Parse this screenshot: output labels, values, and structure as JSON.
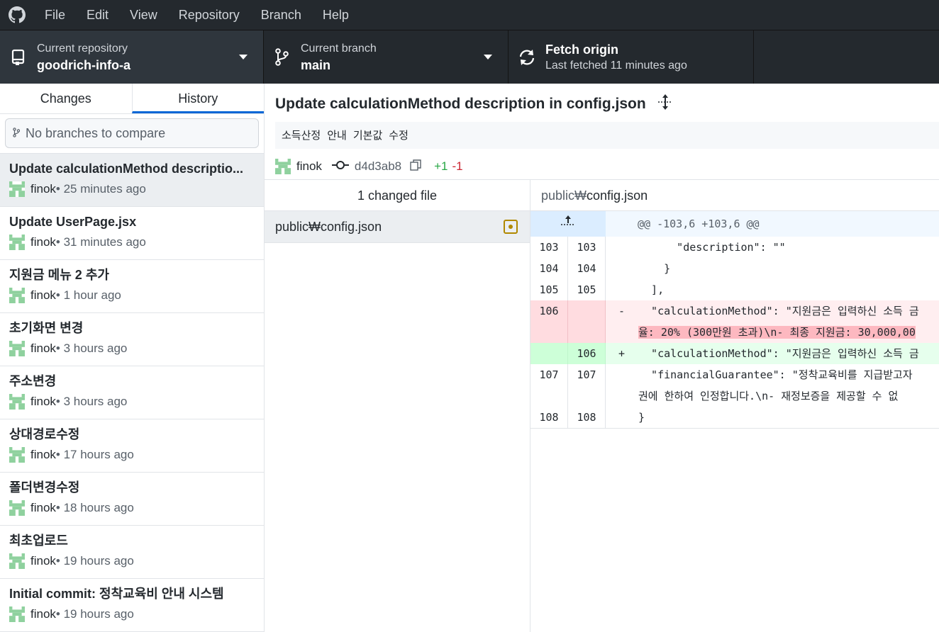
{
  "menu": [
    "File",
    "Edit",
    "View",
    "Repository",
    "Branch",
    "Help"
  ],
  "toolbar": {
    "repo_label": "Current repository",
    "repo_value": "goodrich-info-a",
    "branch_label": "Current branch",
    "branch_value": "main",
    "fetch_label": "Fetch origin",
    "fetch_sub": "Last fetched 11 minutes ago"
  },
  "sidebar": {
    "tabs": [
      "Changes",
      "History"
    ],
    "compare_placeholder": "No branches to compare",
    "commits": [
      {
        "title": "Update calculationMethod descriptio...",
        "author": "finok",
        "time": " • 25 minutes ago"
      },
      {
        "title": "Update UserPage.jsx",
        "author": "finok",
        "time": " • 31 minutes ago"
      },
      {
        "title": "지원금 메뉴 2 추가",
        "author": "finok",
        "time": " • 1 hour ago"
      },
      {
        "title": "초기화면 변경",
        "author": "finok",
        "time": " • 3 hours ago"
      },
      {
        "title": "주소변경",
        "author": "finok",
        "time": " • 3 hours ago"
      },
      {
        "title": "상대경로수정",
        "author": "finok",
        "time": " • 17 hours ago"
      },
      {
        "title": "폴더변경수정",
        "author": "finok",
        "time": " • 18 hours ago"
      },
      {
        "title": "최초업로드",
        "author": "finok",
        "time": " • 19 hours ago"
      },
      {
        "title": "Initial commit: 정착교육비 안내 시스템",
        "author": "finok",
        "time": " • 19 hours ago"
      }
    ]
  },
  "commit": {
    "title": "Update calculationMethod description in config.json",
    "description": "소득산정 안내 기본값 수정",
    "author": "finok",
    "sha": "d4d3ab8",
    "additions": "+1",
    "deletions": "-1"
  },
  "files": {
    "header": "1 changed file",
    "items": [
      "public₩config.json"
    ]
  },
  "diff": {
    "path_prefix": "public₩",
    "path_name": "config.json",
    "hunk": "@@ -103,6 +103,6 @@",
    "rows": [
      {
        "old": "103",
        "new": "103",
        "marker": "",
        "code": "      \"description\": \"\""
      },
      {
        "old": "104",
        "new": "104",
        "marker": "",
        "code": "    }"
      },
      {
        "old": "105",
        "new": "105",
        "marker": "",
        "code": "  ],"
      },
      {
        "old": "106",
        "new": "",
        "marker": "-",
        "code": "  \"calculationMethod\": \"지원금은 입력하신 소득 금"
      },
      {
        "old": "",
        "new": "",
        "marker": "",
        "code": "율: 20% (300만원 초과)\\n- 최종 지원금: 30,000,00"
      },
      {
        "old": "",
        "new": "106",
        "marker": "+",
        "code": "  \"calculationMethod\": \"지원금은 입력하신 소득 금"
      },
      {
        "old": "107",
        "new": "107",
        "marker": "",
        "code": "  \"financialGuarantee\": \"정착교육비를 지급받고자 "
      },
      {
        "old": "",
        "new": "",
        "marker": "",
        "code": "권에 한하여 인정합니다.\\n- 재정보증을 제공할 수 없"
      },
      {
        "old": "108",
        "new": "108",
        "marker": "",
        "code": "}"
      }
    ]
  },
  "colors": {
    "accent": "#0366d6",
    "added": "#28a745",
    "deleted": "#cb2431",
    "modified": "#b08800"
  }
}
